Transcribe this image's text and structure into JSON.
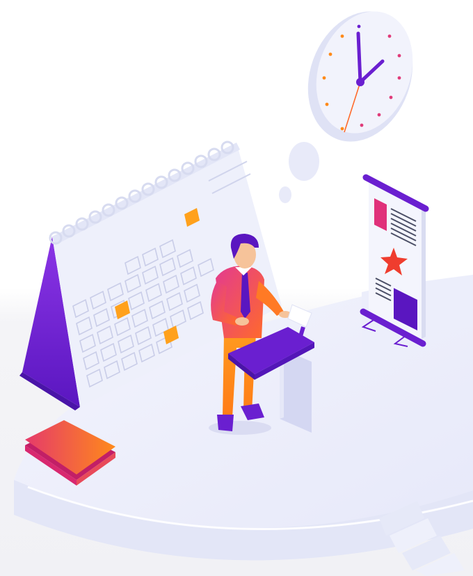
{
  "scene": {
    "subject": "isometric-presenter-with-calendar-and-clock",
    "colors": {
      "background_top": "#ffffff",
      "background_bottom": "#f3f3f6",
      "platform": "#eceefb",
      "platform_edge": "#dfe2f5",
      "purple": "#6a1fd0",
      "purple_dark": "#4a14a8",
      "magenta": "#e0317a",
      "orange": "#ff8a1a",
      "orange_tile": "#ffa11c",
      "calendar_page": "#eef0fb",
      "grid_line": "#c9cde8",
      "red_star": "#ef3d2e"
    },
    "icons": [
      "clock-icon",
      "calendar-icon",
      "banner-icon",
      "star-icon",
      "podium-icon",
      "folder-icon",
      "stairs-icon"
    ]
  }
}
